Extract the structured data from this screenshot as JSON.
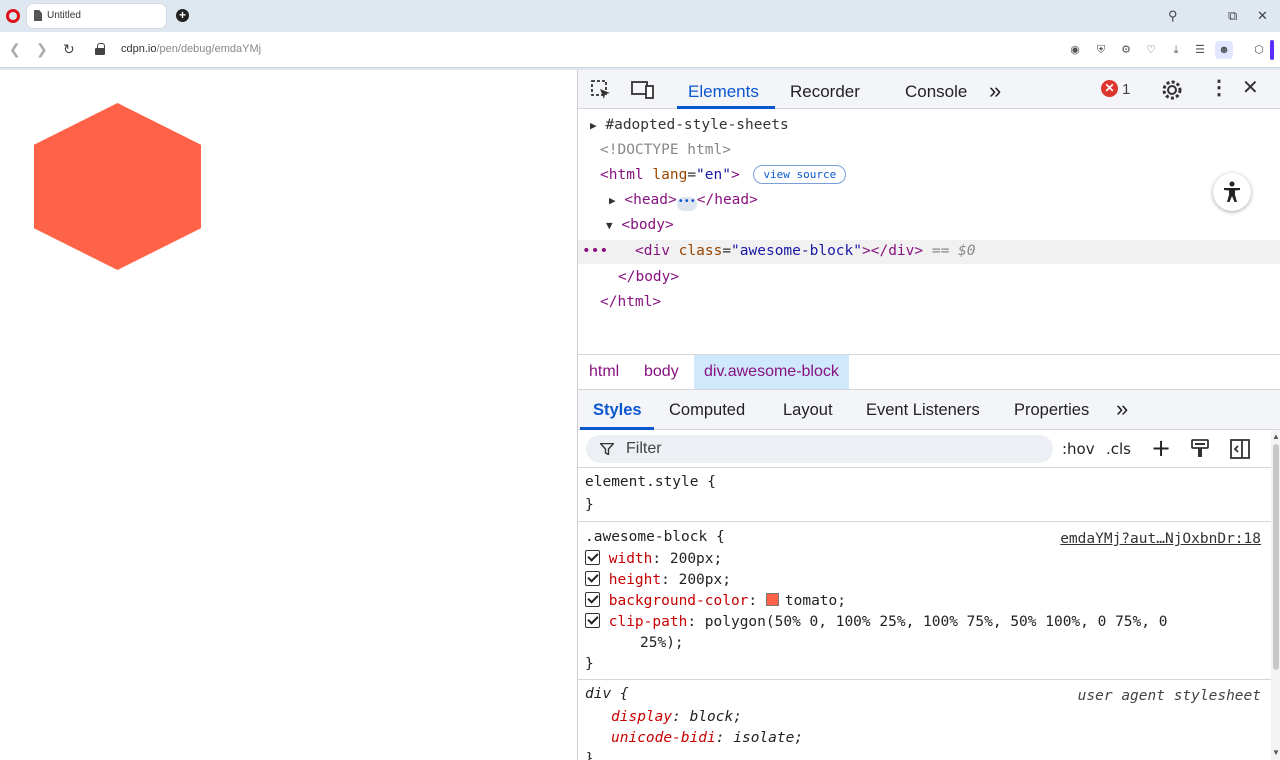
{
  "browser": {
    "tab_title": "Untitled",
    "url_host": "cdpn.io",
    "url_path": "/pen/debug/emdaYMj"
  },
  "page": {
    "hexagon_color": "#ff6347"
  },
  "devtools": {
    "tabs": [
      "Elements",
      "Recorder",
      "Console"
    ],
    "more_tabs": "»",
    "error_count": "1",
    "error_icon": "✕",
    "dom": {
      "adopted": "#adopted-style-sheets",
      "doctype": "<!DOCTYPE html>",
      "html_open_tag": "<html",
      "html_lang_attr": "lang",
      "html_lang_val": "\"en\"",
      "html_open_close": ">",
      "view_source": "view source",
      "head_open": "<head>",
      "head_close": "</head>",
      "head_ellipsis": "•••",
      "body_open": "<body>",
      "div_open": "<div",
      "div_class_attr": "class",
      "div_class_val": "\"awesome-block\"",
      "div_close": "></div>",
      "selected_marker": "== $0",
      "row_dots": "•••",
      "body_close": "</body>",
      "html_close": "</html>"
    },
    "breadcrumb": [
      "html",
      "body",
      "div.awesome-block"
    ],
    "style_tabs": [
      "Styles",
      "Computed",
      "Layout",
      "Event Listeners",
      "Properties"
    ],
    "filter_placeholder": "Filter",
    "filter_buttons": {
      "hov": ":hov",
      "cls": ".cls",
      "add": "+"
    },
    "rules": {
      "element_style_selector": "element.style {",
      "close_brace": "}",
      "awesome_selector": ".awesome-block {",
      "awesome_source": "emdaYMj?aut…NjOxbnDr:18",
      "width_prop": "width",
      "width_val": "200px;",
      "height_prop": "height",
      "height_val": "200px;",
      "bg_prop": "background-color",
      "bg_val": "tomato;",
      "bg_swatch": "#ff6347",
      "clip_prop": "clip-path",
      "clip_val_1": "polygon(50% 0, 100% 25%, 100% 75%, 50% 100%, 0 75%, 0",
      "clip_val_2": "25%);",
      "div_selector": "div {",
      "ua_label": "user agent stylesheet",
      "display_prop": "display",
      "display_val": "block;",
      "unicode_prop": "unicode-bidi",
      "unicode_val": "isolate;"
    }
  }
}
